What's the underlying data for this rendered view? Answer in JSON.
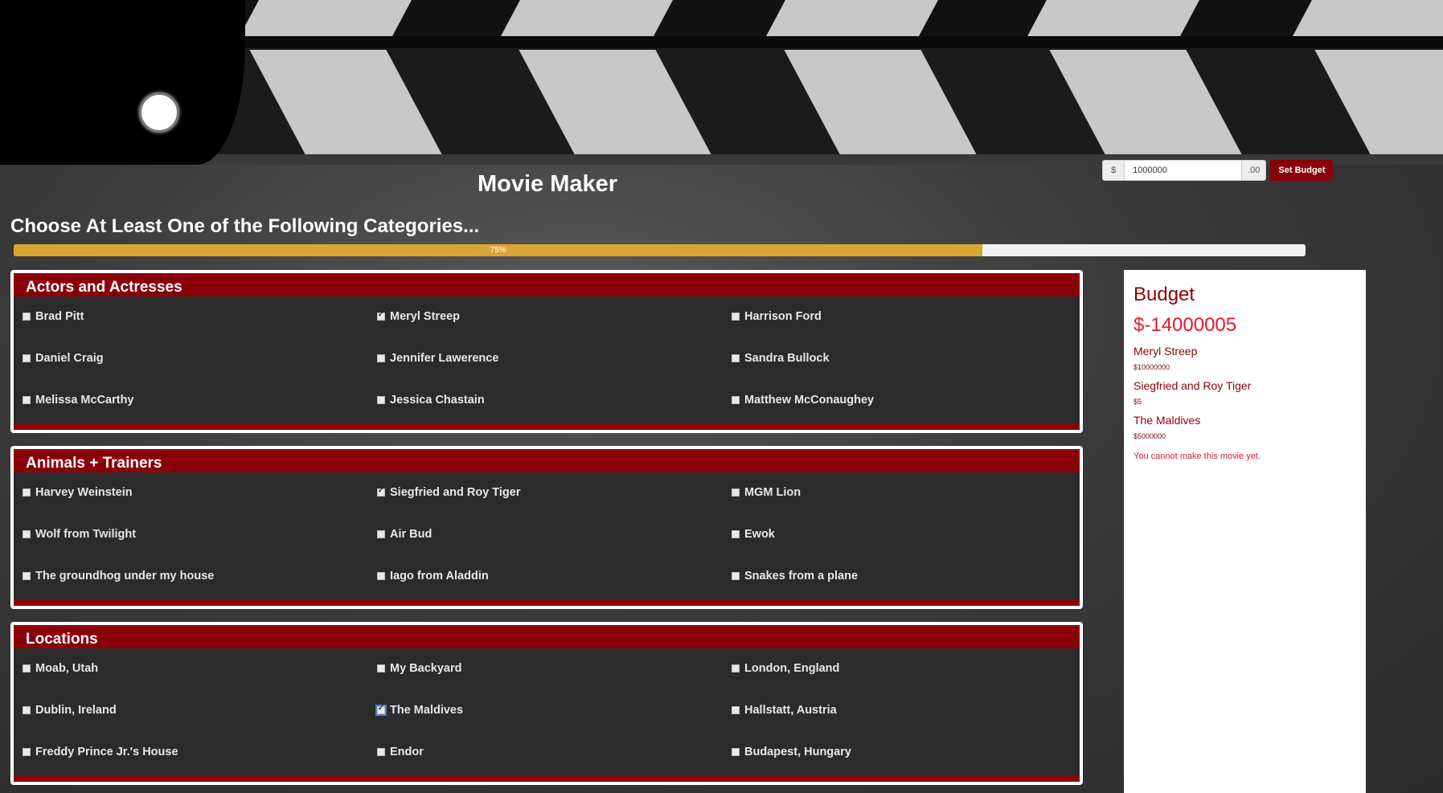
{
  "app": {
    "title": "Movie Maker"
  },
  "budget_form": {
    "currency": "$",
    "value": "1000000",
    "cents": ".00",
    "button_label": "Set Budget"
  },
  "subtitle": "Choose At Least One of the Following Categories...",
  "progress": {
    "percent": 75,
    "label": "75%"
  },
  "colors": {
    "accent": "#8b0008",
    "progress": "#dba534",
    "alert": "#e8172e"
  },
  "categories": [
    {
      "title": "Actors and Actresses",
      "options": [
        {
          "label": "Brad Pitt",
          "checked": false
        },
        {
          "label": "Meryl Streep",
          "checked": true
        },
        {
          "label": "Harrison Ford",
          "checked": false
        },
        {
          "label": "Daniel Craig",
          "checked": false
        },
        {
          "label": "Jennifer Lawerence",
          "checked": false
        },
        {
          "label": "Sandra Bullock",
          "checked": false
        },
        {
          "label": "Melissa McCarthy",
          "checked": false
        },
        {
          "label": "Jessica Chastain",
          "checked": false
        },
        {
          "label": "Matthew McConaughey",
          "checked": false
        }
      ]
    },
    {
      "title": "Animals + Trainers",
      "options": [
        {
          "label": "Harvey Weinstein",
          "checked": false
        },
        {
          "label": "Siegfried and Roy Tiger",
          "checked": true
        },
        {
          "label": "MGM Lion",
          "checked": false
        },
        {
          "label": "Wolf from Twilight",
          "checked": false
        },
        {
          "label": "Air Bud",
          "checked": false
        },
        {
          "label": "Ewok",
          "checked": false
        },
        {
          "label": "The groundhog under my house",
          "checked": false
        },
        {
          "label": "Iago from Aladdin",
          "checked": false
        },
        {
          "label": "Snakes from a plane",
          "checked": false
        }
      ]
    },
    {
      "title": "Locations",
      "options": [
        {
          "label": "Moab, Utah",
          "checked": false
        },
        {
          "label": "My Backyard",
          "checked": false
        },
        {
          "label": "London, England",
          "checked": false
        },
        {
          "label": "Dublin, Ireland",
          "checked": false
        },
        {
          "label": "The Maldives",
          "checked": true,
          "focused": true
        },
        {
          "label": "Hallstatt, Austria",
          "checked": false
        },
        {
          "label": "Freddy Prince Jr.'s House",
          "checked": false
        },
        {
          "label": "Endor",
          "checked": false
        },
        {
          "label": "Budapest, Hungary",
          "checked": false
        }
      ]
    }
  ],
  "budget_summary": {
    "title": "Budget",
    "total": "$-14000005",
    "items": [
      {
        "name": "Meryl Streep",
        "price": "$10000000"
      },
      {
        "name": "Siegfried and Roy Tiger",
        "price": "$5"
      },
      {
        "name": "The Maldives",
        "price": "$5000000"
      }
    ],
    "warning": "You cannot make this movie yet."
  }
}
